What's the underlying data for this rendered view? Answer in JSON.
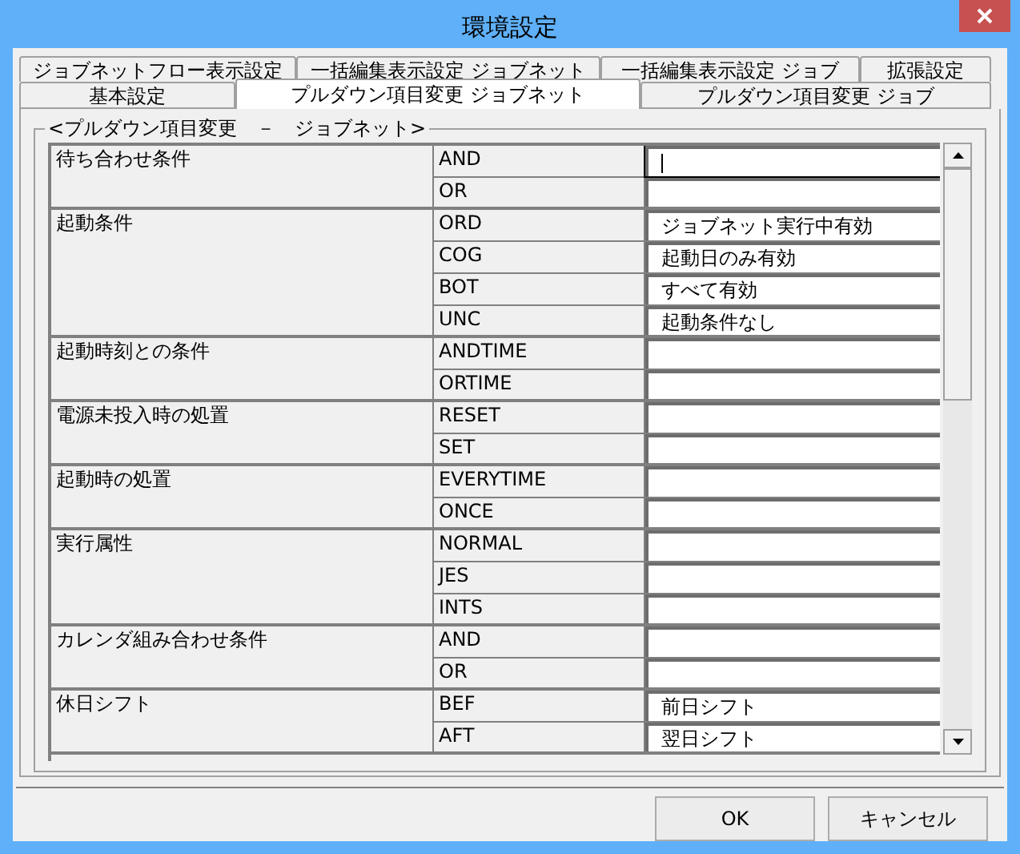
{
  "window": {
    "title": "環境設定"
  },
  "tabs_back": [
    {
      "label": "ジョブネットフロー表示設定",
      "selected": false
    },
    {
      "label": "一括編集表示設定 ジョブネット",
      "selected": false
    },
    {
      "label": "一括編集表示設定 ジョブ",
      "selected": false
    },
    {
      "label": "拡張設定",
      "selected": false
    }
  ],
  "tabs_front": [
    {
      "label": "基本設定",
      "selected": false
    },
    {
      "label": "プルダウン項目変更 ジョブネット",
      "selected": true
    },
    {
      "label": "プルダウン項目変更 ジョブ",
      "selected": false
    }
  ],
  "group": {
    "title": "<プルダウン項目変更　－　ジョブネット>"
  },
  "items": [
    {
      "name": "待ち合わせ条件",
      "options": [
        {
          "code": "AND",
          "focused": true
        },
        {
          "code": "OR",
          "focused": false
        }
      ]
    },
    {
      "name": "起動条件",
      "options": [
        {
          "code": "ORD",
          "value": "ジョブネット実行中有効",
          "focused": false
        },
        {
          "code": "COG",
          "value": "起動日のみ有効",
          "focused": false
        },
        {
          "code": "BOT",
          "value": "すべて有効",
          "focused": false
        },
        {
          "code": "UNC",
          "value": "起動条件なし",
          "focused": false
        }
      ]
    },
    {
      "name": "起動時刻との条件",
      "options": [
        {
          "code": "ANDTIME",
          "focused": false
        },
        {
          "code": "ORTIME",
          "focused": false
        }
      ]
    },
    {
      "name": "電源未投入時の処置",
      "options": [
        {
          "code": "RESET",
          "focused": false
        },
        {
          "code": "SET",
          "focused": false
        }
      ]
    },
    {
      "name": "起動時の処置",
      "options": [
        {
          "code": "EVERYTIME",
          "focused": false
        },
        {
          "code": "ONCE",
          "focused": false
        }
      ]
    },
    {
      "name": "実行属性",
      "options": [
        {
          "code": "NORMAL",
          "focused": false
        },
        {
          "code": "JES",
          "focused": false
        },
        {
          "code": "INTS",
          "focused": false
        }
      ]
    },
    {
      "name": "カレンダ組み合わせ条件",
      "options": [
        {
          "code": "AND",
          "focused": false
        },
        {
          "code": "OR",
          "focused": false
        }
      ]
    },
    {
      "name": "休日シフト",
      "options": [
        {
          "code": "BEF",
          "value": "前日シフト",
          "focused": false
        },
        {
          "code": "AFT",
          "value": "翌日シフト",
          "focused": false
        }
      ]
    }
  ],
  "buttons": [
    {
      "label": "OK"
    },
    {
      "label": "キャンセル"
    }
  ]
}
